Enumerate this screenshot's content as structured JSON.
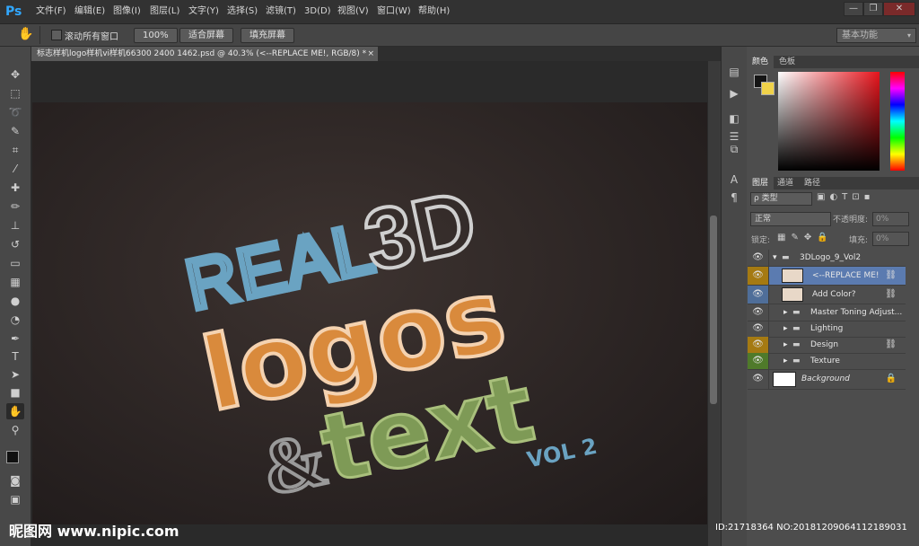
{
  "app": {
    "logo": "Ps"
  },
  "menu": [
    "文件(F)",
    "编辑(E)",
    "图像(I)",
    "图层(L)",
    "文字(Y)",
    "选择(S)",
    "滤镜(T)",
    "3D(D)",
    "视图(V)",
    "窗口(W)",
    "帮助(H)"
  ],
  "window_controls": {
    "minimize": "—",
    "restore": "❐",
    "close": "✕"
  },
  "options": {
    "scroll_all_windows": "滚动所有窗口",
    "zoom_100": "100%",
    "fit_screen": "适合屏幕",
    "fill_screen": "填充屏幕",
    "workspace": "基本功能"
  },
  "document": {
    "tab_title": "标志样机logo样机vi样机66300 2400 1462.psd @ 40.3% (<--REPLACE ME!, RGB/8) *",
    "close": "×"
  },
  "artwork": {
    "line1a": "REAL",
    "line1b": "3D",
    "line2": "logos",
    "line3a": "&",
    "line3b": "text",
    "line4": "VOL 2"
  },
  "color_panel": {
    "tabs": [
      "颜色",
      "色板"
    ]
  },
  "layers_panel": {
    "tabs": [
      "图层",
      "通道",
      "路径"
    ],
    "filter_label": "ρ 类型",
    "blend_mode": "正常",
    "opacity_label": "不透明度:",
    "opacity_value": "0%",
    "lock_label": "锁定:",
    "fill_label": "填充:",
    "fill_value": "0%",
    "layers": [
      {
        "name": "3DLogo_9_Vol2",
        "kind": "group-open"
      },
      {
        "name": "<--REPLACE ME!",
        "kind": "smart",
        "selected": true
      },
      {
        "name": "Add Color?",
        "kind": "smart",
        "eye_color": "#4f6e99"
      },
      {
        "name": "Master Toning Adjust...",
        "kind": "group"
      },
      {
        "name": "Lighting",
        "kind": "group"
      },
      {
        "name": "Design",
        "kind": "group",
        "eye_color": "#a57a12"
      },
      {
        "name": "Texture",
        "kind": "group",
        "eye_color": "#4f7a2a"
      },
      {
        "name": "Background",
        "kind": "background"
      }
    ]
  },
  "overlay": {
    "watermark": "昵图网 www.nipic.com",
    "id_text": "ID:21718364 NO:20181209064112189031"
  },
  "colors": {
    "accent": "#31a8ff",
    "selected_layer": "#5b7bb0",
    "orange": "#d98a3c",
    "green": "#7e9a56",
    "blue": "#6aa3c2"
  }
}
